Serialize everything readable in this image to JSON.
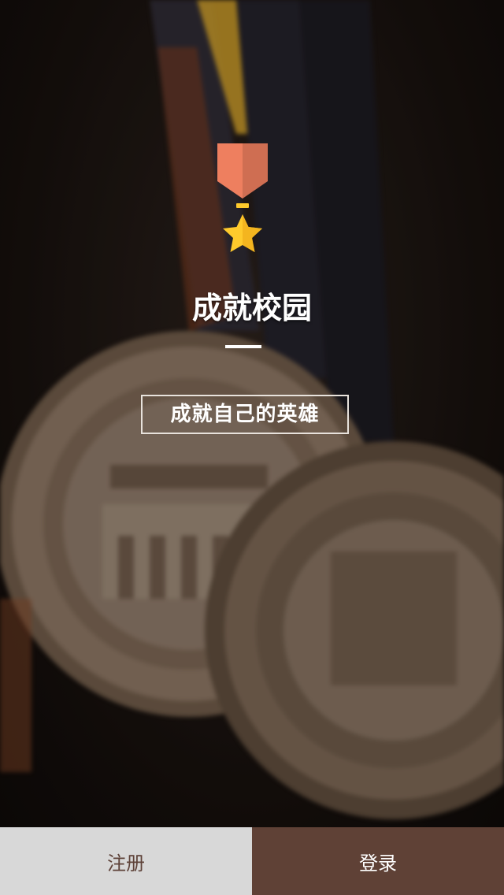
{
  "app": {
    "title": "成就校园",
    "tagline": "成就自己的英雄"
  },
  "actions": {
    "register_label": "注册",
    "login_label": "登录"
  },
  "colors": {
    "ribbon_left": "#ee7f5f",
    "ribbon_right": "#cf6e52",
    "star": "#ffca2c",
    "register_bg": "#d8d8d8",
    "register_text": "#5e4239",
    "login_bg": "#5f4136",
    "login_text": "#ffffff"
  },
  "icons": {
    "logo": "medal-icon"
  }
}
